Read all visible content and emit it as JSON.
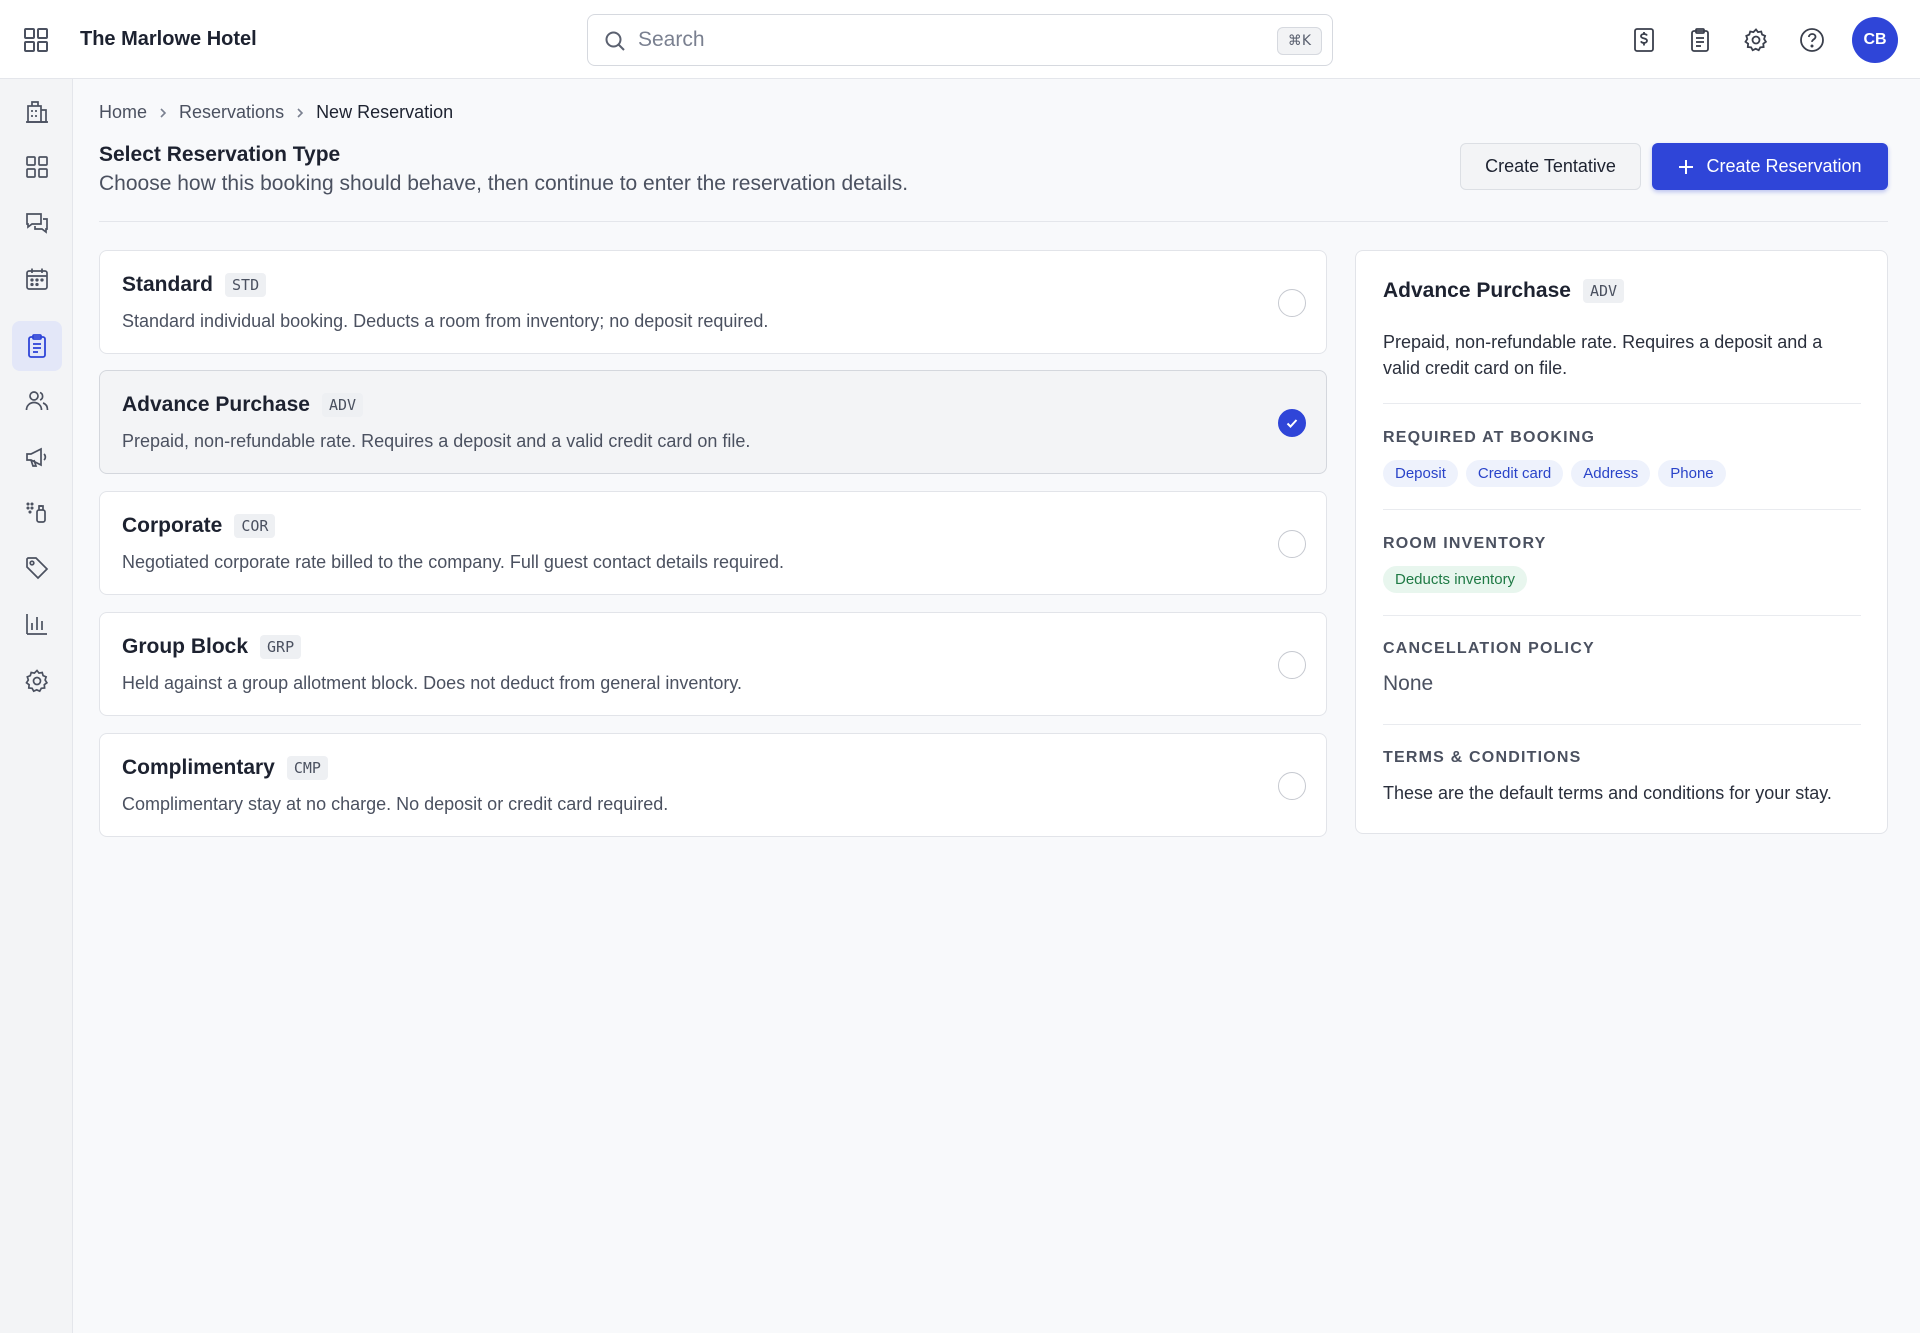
{
  "header": {
    "hotel_name": "The Marlowe Hotel",
    "search_placeholder": "Search",
    "search_shortcut": "⌘K",
    "avatar_initials": "CB"
  },
  "breadcrumb": {
    "items": [
      "Home",
      "Reservations"
    ],
    "current": "New Reservation"
  },
  "page": {
    "title": "Select Reservation Type",
    "subtitle": "Choose how this booking should behave, then continue to enter the reservation details.",
    "secondary_button": "Create Tentative",
    "primary_button": "Create Reservation"
  },
  "options": [
    {
      "title": "Standard",
      "code": "STD",
      "description": "Standard individual booking. Deducts a room from inventory; no deposit required.",
      "selected": false
    },
    {
      "title": "Advance Purchase",
      "code": "ADV",
      "description": "Prepaid, non-refundable rate. Requires a deposit and a valid credit card on file.",
      "selected": true
    },
    {
      "title": "Corporate",
      "code": "COR",
      "description": "Negotiated corporate rate billed to the company. Full guest contact details required.",
      "selected": false
    },
    {
      "title": "Group Block",
      "code": "GRP",
      "description": "Held against a group allotment block. Does not deduct from general inventory.",
      "selected": false
    },
    {
      "title": "Complimentary",
      "code": "CMP",
      "description": "Complimentary stay at no charge. No deposit or credit card required.",
      "selected": false
    }
  ],
  "detail": {
    "title": "Advance Purchase",
    "code": "ADV",
    "description": "Prepaid, non-refundable rate. Requires a deposit and a valid credit card on file.",
    "required_label": "REQUIRED AT BOOKING",
    "required_chips": [
      "Deposit",
      "Credit card",
      "Address",
      "Phone"
    ],
    "inventory_label": "ROOM INVENTORY",
    "inventory_chip": "Deducts inventory",
    "cancellation_label": "CANCELLATION POLICY",
    "cancellation_value": "None",
    "terms_label": "TERMS & CONDITIONS",
    "terms_value": "These are the default terms and conditions for your stay."
  },
  "colors": {
    "accent": "#2f45d8",
    "chip_blue_text": "#2a44c9",
    "chip_green_text": "#1f7a45"
  },
  "icons": {
    "top": [
      "apps-grid-icon",
      "search-icon",
      "invoice-dollar-icon",
      "clipboard-icon",
      "gear-icon",
      "help-circle-icon"
    ],
    "sidebar": [
      "building-icon",
      "dashboard-icon",
      "messages-icon",
      "calendar-icon",
      "clipboard-list-icon",
      "users-icon",
      "megaphone-icon",
      "housekeeping-icon",
      "tag-icon",
      "bar-chart-icon",
      "settings-icon"
    ]
  }
}
